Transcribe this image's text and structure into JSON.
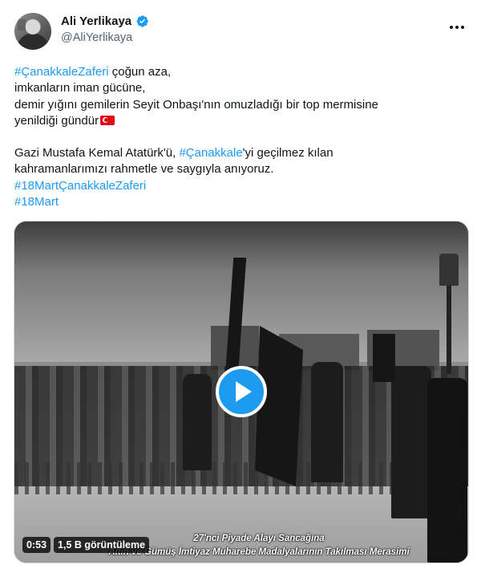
{
  "author": {
    "display_name": "Ali Yerlikaya",
    "handle": "@AliYerlikaya",
    "verified_color": "#1d9bf0"
  },
  "tweet": {
    "lines": [
      {
        "tag": "#ÇanakkaleZaferi",
        "text": " çoğun aza,"
      },
      {
        "text": "imkanların iman gücüne,"
      },
      {
        "text": "demir yığını gemilerin Seyit Onbaşı'nın omuzladığı bir top mermisine"
      },
      {
        "text": "yenildiği gündür"
      },
      {
        "pre": "Gazi Mustafa Kemal Atatürk'ü, ",
        "tag": "#Çanakkale",
        "post": "'yi geçilmez kılan"
      },
      {
        "text": "kahramanlarımızı rahmetle ve saygıyla anıyoruz."
      },
      {
        "tag": "#18MartÇanakkaleZaferi"
      },
      {
        "tag": "#18Mart"
      }
    ],
    "link_color": "#1d9bf0"
  },
  "video": {
    "duration": "0:53",
    "views": "1,5 B görüntüleme",
    "caption_line1": "27'nci Piyade Alayı Sancağına",
    "caption_line2": "Altın ve Gümüş İmtiyaz Muharebe Madalyalarının Takılması Merasimi",
    "play_icon": "play-icon"
  }
}
